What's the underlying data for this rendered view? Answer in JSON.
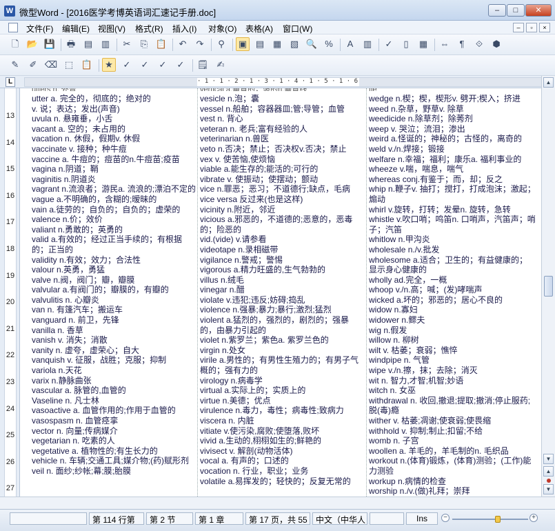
{
  "window": {
    "app_icon": "W",
    "title": "微型Word - [2016医学考博英语词汇速记手册.doc]",
    "minimize_icon": "minimize-icon",
    "maximize_icon": "maximize-icon",
    "close_icon": "close-icon",
    "min_glyph": "‒",
    "max_glyph": "□",
    "close_glyph": "✕"
  },
  "menu": {
    "items": [
      "文件(F)",
      "编辑(E)",
      "视图(V)",
      "格式(R)",
      "插入(I)",
      "对象(O)",
      "表格(A)",
      "窗口(W)"
    ],
    "mdi_min": "–",
    "mdi_restore": "▫",
    "mdi_close": "×"
  },
  "toolbar1": {
    "icons": [
      "new-document-icon",
      "open-folder-icon",
      "save-icon",
      "print-icon",
      "pdf-icon",
      "print-preview-icon",
      "cut-icon",
      "copy-icon",
      "paste-icon",
      "undo-icon",
      "redo-icon",
      "find-icon",
      "page-layout-icon",
      "outline-view-icon",
      "normal-view-icon",
      "web-view-icon",
      "zoom-icon",
      "percent-icon",
      "font-color-icon",
      "format-icon",
      "spellcheck-icon",
      "column-icon",
      "table-icon",
      "split-icon",
      "paragraph-mark-icon",
      "text-flow-icon",
      "object-icon"
    ],
    "glyphs": [
      "🗋",
      "📂",
      "💾",
      "🖶",
      "▤",
      "▥",
      "✂",
      "⎘",
      "📋",
      "↶",
      "↷",
      "⚲",
      "▣",
      "▤",
      "▦",
      "▧",
      "🔍",
      "%",
      "A",
      "▥",
      "✓",
      "▯",
      "▦",
      "⇔",
      "¶",
      "⟐",
      "⬢"
    ]
  },
  "toolbar2": {
    "icons": [
      "highlight-icon",
      "edit-pen-icon",
      "eraser-icon",
      "clear-format-icon",
      "clipboard-icon",
      "star-icon",
      "mark-1-icon",
      "mark-2-icon",
      "mark-3-icon",
      "mark-4-icon",
      "notes-icon",
      "properties-icon"
    ],
    "glyphs": [
      "✎",
      "✐",
      "⌫",
      "⬚",
      "📋",
      "★",
      "✓",
      "✓",
      "✓",
      "✓",
      "🗒",
      "✍"
    ]
  },
  "ruler": {
    "corner": "L",
    "ticks": [
      "· 1 · 1 · 2 · 1 · 3 · 1 · 4 · 1 · 5 · 1 · 6"
    ]
  },
  "vertical_ruler": {
    "numbers": [
      "13",
      "14",
      "15",
      "16",
      "17",
      "18",
      "19",
      "20",
      "21",
      "22",
      "23",
      "24",
      "25",
      "26",
      "27"
    ]
  },
  "columns": {
    "left_cut": "utters n. 外音",
    "middle_cut": "vertical a.垂直的，竖的n.垂直线",
    "right_cut": "tie",
    "left": [
      "utter a. 完全的，彻底的；绝对的",
      "v. 说；表达；发出(声音)",
      "uvula n. 悬雍垂，小舌",
      "vacant a. 空的；未占用的",
      "vacation n. 休假，假期v. 休假",
      "vaccinate v. 接种；种牛痘",
      "vaccine a. 牛痘的；痘苗的n.牛痘苗;疫苗",
      "vagina n.阴道；鞘",
      "vaginitis n.阴道炎",
      "vagrant n.流浪者；游民a. 流浪的;漂泊不定的",
      "vague a.不明确的，含糊的;暧昧的",
      "vain a.徒劳的；自负的；自负的；虚荣的",
      "valence n.价；效价",
      "valiant n.勇敢的；英勇的",
      "valid a.有效的；经过正当手续的；有根据的；正当的",
      "validity n.有效；效力；合法性",
      "valour n.英勇，勇猛",
      "valve n.阀，阀门；瓣，瓣膜",
      "valvular a.有阀门的；瓣膜的，有瓣的",
      "valvulitis n. 心瓣炎",
      "van n. 有篷汽车；搬运车",
      "vanguard n. 前卫，先锋",
      "vanilla n. 香草",
      "vanish v. 消失；消散",
      "vanity n. 虚夸，虚荣心；自大",
      "vanquish v. 征服，战胜；克服；抑制",
      "variola n.天花",
      "varix n.静脉曲张",
      "vascular a. 脉管的,血管的",
      "Vaseline n. 凡士林",
      "vasoactive a. 血管作用的;作用于血管的",
      "vasospasm n. 血管痉挛",
      "vector n. 向量;传病媒介",
      "vegetarian n. 吃素的人",
      "vegetative a. 植物性的;有生长力的",
      "vehicle n. 车辆;交通工具;媒介物;(药)赋形剂",
      "veil n. 面纱;纱帐;幕;膜;胎膜"
    ],
    "middle": [
      "vesicle n.泡；囊",
      "vessel n.船舶；容器器皿;管;导管；血管",
      "vest n. 背心",
      "veteran n. 老兵;富有经验的人",
      "veterinarian n.兽医",
      "veto n.否决；禁止；否决权v.否决；禁止",
      "vex v. 使苦恼,使烦恼",
      "viable a.能生存的;能活的;可行的",
      "vibrate v. 使振动；使摆动；颤动",
      "vice n.罪恶；恶习；不道德行;缺点，毛病",
      "vice versa 反过来(也是这样)",
      "vicinity n.附近，邻近",
      "vicious a.邪恶的，不道德的;恶意的，恶毒的；险恶的",
      "vid.(vide) v.请参看",
      "videotape n.录相磁带",
      "vigilance n.警戒；警惕",
      "vigorous a.精力旺盛的,生气勃勃的",
      "villus n.绒毛",
      "vinegar n.醋",
      "violate v.违犯;违反;妨碍;捣乱",
      "violence n.强暴;暴力;暴行;激烈;猛烈",
      "violent a.猛烈的，强烈的，剧烈的；强暴的，由暴力引起的",
      "violet n.紫罗兰；紫色a. 紫罗兰色的",
      "virgin n.处女",
      "virile a.男性的；有男性生殖力的；有男子气概的；强有力的",
      "virology n.病毒学",
      "virtual a.实际上的；实质上的",
      "virtue n.美德；优点",
      "virulence n.毒力，毒性；病毒性;致病力",
      "viscera n. 内脏",
      "vitiate v.使污染,腐败;使堕落,败坏",
      "vivid a.生动的,栩栩如生的;鲜艳的",
      "vivisect v. 解剖(动物活体)",
      "vocal a. 有声的；口述的",
      "vocation n. 行业，职业；业务",
      "volatile a.易挥发的；轻快的；反复无常的"
    ],
    "right": [
      "wedge n.楔；楔，楔形v. 劈开;楔入；挤进",
      "weed n.杂草，野草v. 除草",
      "weedicide n.除草剂；除莠剂",
      "weep v. 哭泣；流泪；渗出",
      "weird a.怪诞的；神秘的；古怪的，离奇的",
      "weld v./n.焊接；锻接",
      "welfare n.幸福；福利；康乐a. 福利事业的",
      "wheeze v.喘，喘息，喘气",
      "whereas conj.有鉴于；而，却；反之",
      "whip n.鞭子v. 抽打；搅打，打成泡沫；激起；煽动",
      "whirl v.旋转，打转；发晕n. 旋转，急转",
      "whistle v.吹口哨；鸣笛n. 口哨声，汽笛声；哨子；汽笛",
      "whitlow n.甲沟炎",
      "wholesale n./v.批发",
      "wholesome a.适合；卫生的；有益健康的；显示身心健康的",
      "wholly ad.完全，一概",
      "whoop v./n.高；喊；(发)哮喘声",
      "wicked a.坏的；邪恶的；居心不良的",
      "widow n.寡妇",
      "widower n.鳏夫",
      "wig n.假发",
      "willow n. 柳树",
      "wilt v. 枯萎；衰弱；憔悴",
      "windpipe n. 气管",
      "wipe v./n.擦，抹；去除；消灭",
      "wit n. 智力,才智;机智;妙语",
      "witch n. 女巫",
      "withdrawal n. 收回,撤退;提取;撤消;停止服药;脱(毒)瘾",
      "wither v. 枯萎;凋谢;使衰弱;使畏缩",
      "withhold v. 抑制;制止;扣留;不给",
      "womb n. 子宫",
      "woollen a. 羊毛的，羊毛制的n. 毛织品",
      "workout n.(体育)锻炼，(体育)测验；(工作)能力测验",
      "workup n.病情的检查",
      "worship n./v.(做)礼拜；崇拜"
    ]
  },
  "scrollbar": {
    "up_glyph": "▲",
    "down_glyph": "▼",
    "prev_page_glyph": "▲",
    "next_page_glyph": "▼"
  },
  "status": {
    "line": "第 114 行第",
    "section": "第 2 节",
    "chapter": "第 1 章",
    "page": "第 17 页，共 55",
    "language": "中文（中华人",
    "mode": "Ins",
    "zoom_minus": "−",
    "zoom_plus": "+",
    "zoom_level": 0.6
  }
}
